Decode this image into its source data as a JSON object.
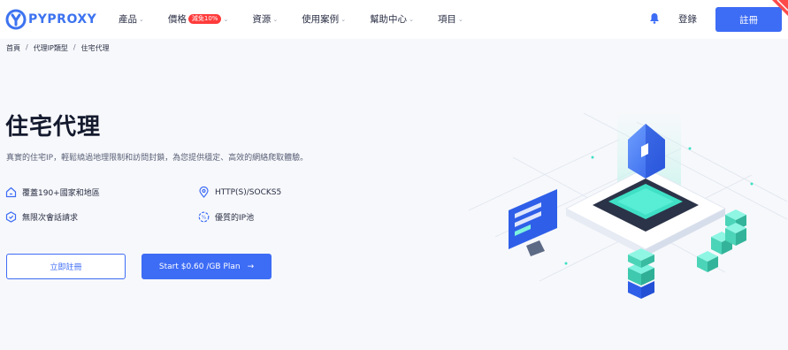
{
  "header": {
    "logo_text": "PYPROXY",
    "menu": [
      {
        "label": "產品"
      },
      {
        "label": "價格",
        "badge": "減免10%"
      },
      {
        "label": "資源"
      },
      {
        "label": "使用案例"
      },
      {
        "label": "幫助中心"
      },
      {
        "label": "項目"
      }
    ],
    "login_label": "登錄",
    "signup_label": "註冊"
  },
  "breadcrumb": {
    "home": "首頁",
    "sep": "/",
    "category": "代理IP類型",
    "current": "住宅代理"
  },
  "hero": {
    "title": "住宅代理",
    "subtitle": "真實的住宅IP，輕鬆繞過地理限制和訪問封鎖，為您提供穩定、高效的網絡爬取體驗。",
    "features": [
      {
        "label": "覆蓋190+國家和地區",
        "icon": "home-icon"
      },
      {
        "label": "HTTP(S)/SOCKS5",
        "icon": "location-pin-icon"
      },
      {
        "label": "無限次會話請求",
        "icon": "hexagon-icon"
      },
      {
        "label": "優質的IP池",
        "icon": "percent-icon"
      }
    ],
    "cta_secondary": "立即註冊",
    "cta_primary": "Start $0.60 /GB Plan",
    "cta_arrow": "→"
  },
  "colors": {
    "accent": "#3d6cf5",
    "badge": "#ff3b3b",
    "teal": "#3fe0c5"
  }
}
